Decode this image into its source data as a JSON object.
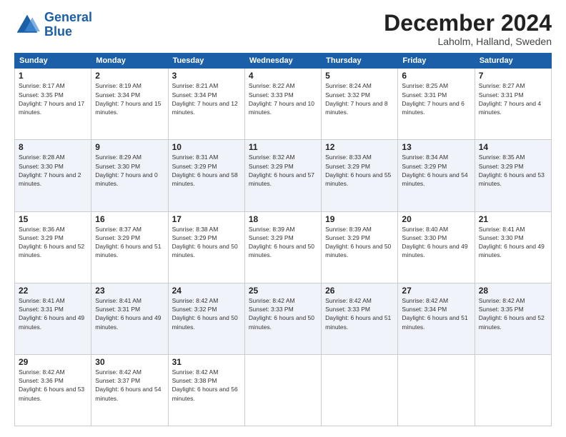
{
  "header": {
    "logo_line1": "General",
    "logo_line2": "Blue",
    "month_title": "December 2024",
    "location": "Laholm, Halland, Sweden"
  },
  "weekdays": [
    "Sunday",
    "Monday",
    "Tuesday",
    "Wednesday",
    "Thursday",
    "Friday",
    "Saturday"
  ],
  "weeks": [
    [
      {
        "day": "1",
        "sunrise": "8:17 AM",
        "sunset": "3:35 PM",
        "daylight": "7 hours and 17 minutes."
      },
      {
        "day": "2",
        "sunrise": "8:19 AM",
        "sunset": "3:34 PM",
        "daylight": "7 hours and 15 minutes."
      },
      {
        "day": "3",
        "sunrise": "8:21 AM",
        "sunset": "3:34 PM",
        "daylight": "7 hours and 12 minutes."
      },
      {
        "day": "4",
        "sunrise": "8:22 AM",
        "sunset": "3:33 PM",
        "daylight": "7 hours and 10 minutes."
      },
      {
        "day": "5",
        "sunrise": "8:24 AM",
        "sunset": "3:32 PM",
        "daylight": "7 hours and 8 minutes."
      },
      {
        "day": "6",
        "sunrise": "8:25 AM",
        "sunset": "3:31 PM",
        "daylight": "7 hours and 6 minutes."
      },
      {
        "day": "7",
        "sunrise": "8:27 AM",
        "sunset": "3:31 PM",
        "daylight": "7 hours and 4 minutes."
      }
    ],
    [
      {
        "day": "8",
        "sunrise": "8:28 AM",
        "sunset": "3:30 PM",
        "daylight": "7 hours and 2 minutes."
      },
      {
        "day": "9",
        "sunrise": "8:29 AM",
        "sunset": "3:30 PM",
        "daylight": "7 hours and 0 minutes."
      },
      {
        "day": "10",
        "sunrise": "8:31 AM",
        "sunset": "3:29 PM",
        "daylight": "6 hours and 58 minutes."
      },
      {
        "day": "11",
        "sunrise": "8:32 AM",
        "sunset": "3:29 PM",
        "daylight": "6 hours and 57 minutes."
      },
      {
        "day": "12",
        "sunrise": "8:33 AM",
        "sunset": "3:29 PM",
        "daylight": "6 hours and 55 minutes."
      },
      {
        "day": "13",
        "sunrise": "8:34 AM",
        "sunset": "3:29 PM",
        "daylight": "6 hours and 54 minutes."
      },
      {
        "day": "14",
        "sunrise": "8:35 AM",
        "sunset": "3:29 PM",
        "daylight": "6 hours and 53 minutes."
      }
    ],
    [
      {
        "day": "15",
        "sunrise": "8:36 AM",
        "sunset": "3:29 PM",
        "daylight": "6 hours and 52 minutes."
      },
      {
        "day": "16",
        "sunrise": "8:37 AM",
        "sunset": "3:29 PM",
        "daylight": "6 hours and 51 minutes."
      },
      {
        "day": "17",
        "sunrise": "8:38 AM",
        "sunset": "3:29 PM",
        "daylight": "6 hours and 50 minutes."
      },
      {
        "day": "18",
        "sunrise": "8:39 AM",
        "sunset": "3:29 PM",
        "daylight": "6 hours and 50 minutes."
      },
      {
        "day": "19",
        "sunrise": "8:39 AM",
        "sunset": "3:29 PM",
        "daylight": "6 hours and 50 minutes."
      },
      {
        "day": "20",
        "sunrise": "8:40 AM",
        "sunset": "3:30 PM",
        "daylight": "6 hours and 49 minutes."
      },
      {
        "day": "21",
        "sunrise": "8:41 AM",
        "sunset": "3:30 PM",
        "daylight": "6 hours and 49 minutes."
      }
    ],
    [
      {
        "day": "22",
        "sunrise": "8:41 AM",
        "sunset": "3:31 PM",
        "daylight": "6 hours and 49 minutes."
      },
      {
        "day": "23",
        "sunrise": "8:41 AM",
        "sunset": "3:31 PM",
        "daylight": "6 hours and 49 minutes."
      },
      {
        "day": "24",
        "sunrise": "8:42 AM",
        "sunset": "3:32 PM",
        "daylight": "6 hours and 50 minutes."
      },
      {
        "day": "25",
        "sunrise": "8:42 AM",
        "sunset": "3:33 PM",
        "daylight": "6 hours and 50 minutes."
      },
      {
        "day": "26",
        "sunrise": "8:42 AM",
        "sunset": "3:33 PM",
        "daylight": "6 hours and 51 minutes."
      },
      {
        "day": "27",
        "sunrise": "8:42 AM",
        "sunset": "3:34 PM",
        "daylight": "6 hours and 51 minutes."
      },
      {
        "day": "28",
        "sunrise": "8:42 AM",
        "sunset": "3:35 PM",
        "daylight": "6 hours and 52 minutes."
      }
    ],
    [
      {
        "day": "29",
        "sunrise": "8:42 AM",
        "sunset": "3:36 PM",
        "daylight": "6 hours and 53 minutes."
      },
      {
        "day": "30",
        "sunrise": "8:42 AM",
        "sunset": "3:37 PM",
        "daylight": "6 hours and 54 minutes."
      },
      {
        "day": "31",
        "sunrise": "8:42 AM",
        "sunset": "3:38 PM",
        "daylight": "6 hours and 56 minutes."
      },
      null,
      null,
      null,
      null
    ]
  ]
}
